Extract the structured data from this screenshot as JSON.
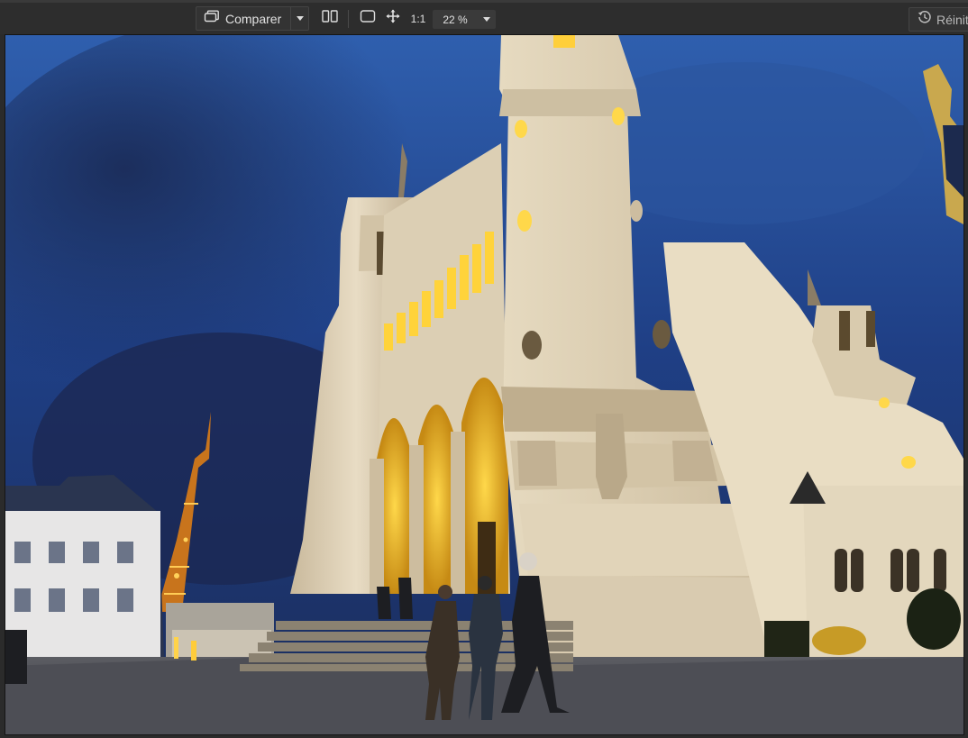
{
  "toolbar": {
    "compare_label": "Comparer",
    "zoom_value": "22 %",
    "one_to_one_label": "1:1",
    "reset_label": "Réinitialiser"
  },
  "icons": {
    "compare": "compare-icon",
    "split_view": "split-view-icon",
    "fit_screen": "fit-screen-icon",
    "move": "move-icon",
    "reset": "history-icon"
  }
}
